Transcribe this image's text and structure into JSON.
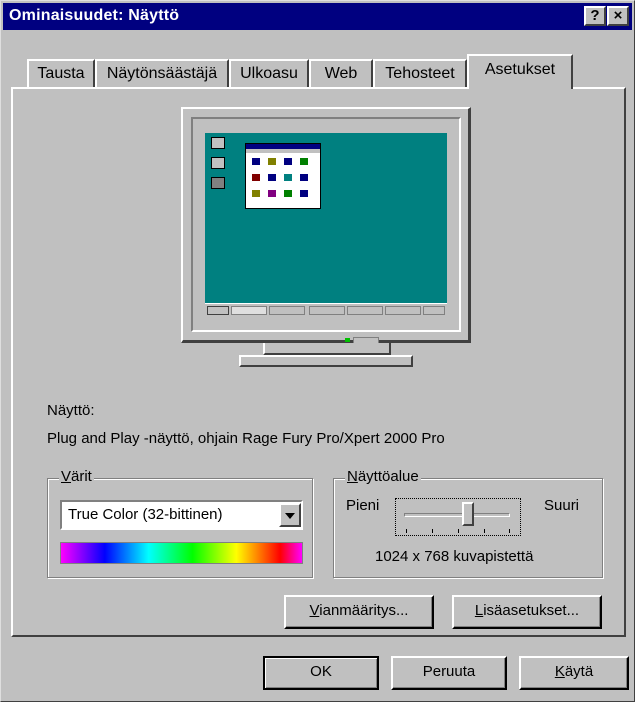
{
  "window": {
    "title": "Ominaisuudet: Näyttö"
  },
  "titlebar_buttons": {
    "help": "?",
    "close": "×"
  },
  "tabs": [
    {
      "label": "Tausta"
    },
    {
      "label": "Näytönsäästäjä"
    },
    {
      "label": "Ulkoasu"
    },
    {
      "label": "Web"
    },
    {
      "label": "Tehosteet"
    },
    {
      "label": "Asetukset"
    }
  ],
  "active_tab": "Asetukset",
  "monitor_preview": {
    "taskbar_items": [
      "",
      "",
      "",
      "",
      "",
      ""
    ],
    "icons": [
      "computer-icon",
      "network-icon",
      "recycle-icon"
    ]
  },
  "display": {
    "label": "Näyttö:",
    "value": "Plug and Play -näyttö, ohjain Rage Fury Pro/Xpert 2000 Pro"
  },
  "colors": {
    "legend_mn": "V",
    "legend_rest": "ärit",
    "selected": "True Color (32-bittinen)"
  },
  "screen_area": {
    "legend_mn": "N",
    "legend_rest": "äyttöalue",
    "min_label": "Pieni",
    "max_label": "Suuri",
    "resolution": "1024 x 768 kuvapistettä",
    "slider_fraction": 0.6
  },
  "buttons": {
    "troubleshoot_mn": "V",
    "troubleshoot_rest": "ianmääritys...",
    "advanced_mn": "L",
    "advanced_rest": "isäasetukset...",
    "ok": "OK",
    "cancel": "Peruuta",
    "apply_mn": "K",
    "apply_rest": "äytä"
  }
}
